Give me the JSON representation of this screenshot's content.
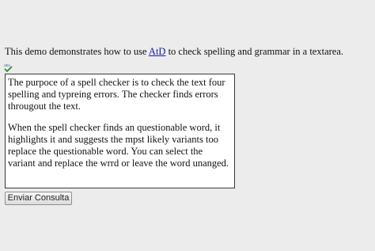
{
  "intro": {
    "before_link": "This demo demonstrates how to use ",
    "link_text": "AtD",
    "after_link": " to check spelling and grammar in a textarea."
  },
  "spell_icon": {
    "name": "spellcheck-icon",
    "text": "abc",
    "check_color": "#2e8b2e",
    "text_color": "#3355aa"
  },
  "textarea": {
    "paragraphs": [
      "The purpoce of a spell checker is to check the text four spelling and typreing errors. The checker finds errors througout the text.",
      "When the spell checker finds an questionable word, it highlights it and suggests the mpst likely variants too replace the questionable word. You can select the variant and replace the wrrd or leave the word unanged."
    ]
  },
  "form": {
    "submit_label": "Enviar Consulta"
  }
}
